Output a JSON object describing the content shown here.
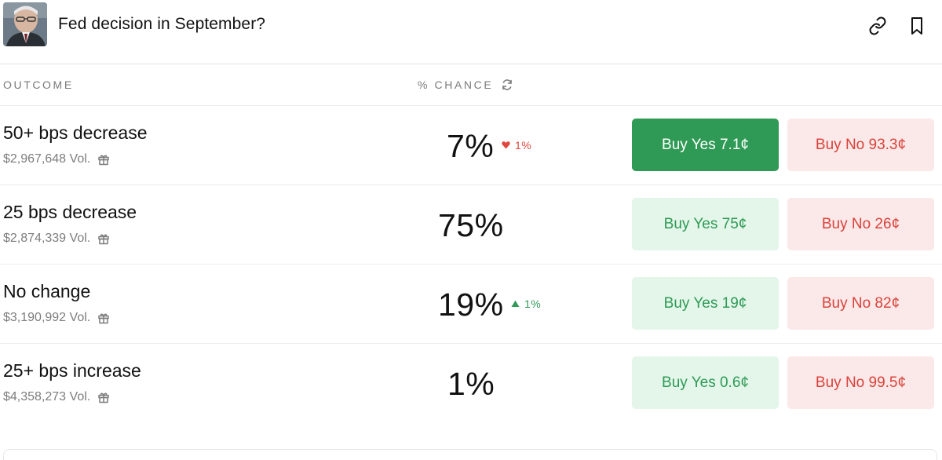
{
  "header": {
    "title": "Fed decision in September?",
    "link_icon": "link-icon",
    "bookmark_icon": "bookmark-icon"
  },
  "table": {
    "col_outcome": "OUTCOME",
    "col_chance": "% CHANCE",
    "refresh_icon": "refresh-icon"
  },
  "rows": [
    {
      "name": "50+ bps decrease",
      "volume": "$2,967,648 Vol.",
      "chance": "7%",
      "change": "1%",
      "change_dir": "down",
      "buy_yes": "Buy Yes 7.1¢",
      "buy_no": "Buy No 93.3¢",
      "yes_active": true
    },
    {
      "name": "25 bps decrease",
      "volume": "$2,874,339 Vol.",
      "chance": "75%",
      "change": "",
      "change_dir": "none",
      "buy_yes": "Buy Yes 75¢",
      "buy_no": "Buy No 26¢",
      "yes_active": false
    },
    {
      "name": "No change",
      "volume": "$3,190,992 Vol.",
      "chance": "19%",
      "change": "1%",
      "change_dir": "up",
      "buy_yes": "Buy Yes 19¢",
      "buy_no": "Buy No 82¢",
      "yes_active": false
    },
    {
      "name": "25+ bps increase",
      "volume": "$4,358,273 Vol.",
      "chance": "1%",
      "change": "",
      "change_dir": "none",
      "buy_yes": "Buy Yes 0.6¢",
      "buy_no": "Buy No 99.5¢",
      "yes_active": false
    }
  ],
  "colors": {
    "yes_active_bg": "#2f9a55",
    "yes_bg": "#e3f6e9",
    "yes_text": "#2e9a56",
    "no_bg": "#fbe8e8",
    "no_text": "#d9433b",
    "down": "#e0473f",
    "up": "#2f9a58"
  }
}
